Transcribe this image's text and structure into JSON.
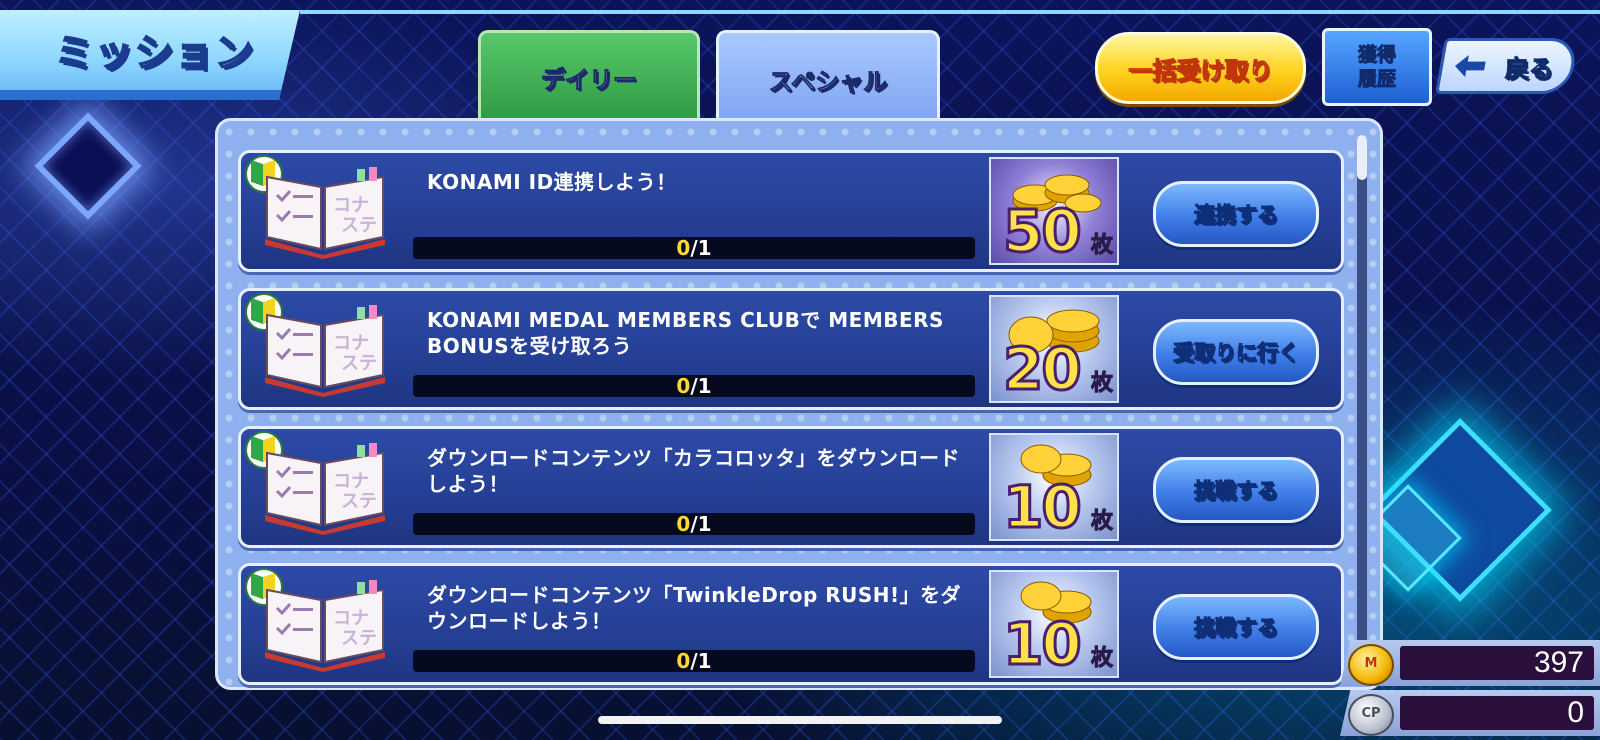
{
  "header": {
    "title": "ミッション"
  },
  "tabs": [
    {
      "label": "デイリー",
      "active": false
    },
    {
      "label": "スペシャル",
      "active": true
    }
  ],
  "toolbar": {
    "bulk_receive_label": "一括受け取り",
    "history_label_line1": "獲得",
    "history_label_line2": "履歴",
    "back_label": "戻る"
  },
  "missions": [
    {
      "title": "KONAMI ID連携しよう！",
      "progress_current": "0",
      "progress_total": "/1",
      "reward_amount": "50",
      "reward_unit": "枚",
      "action_label": "連携する"
    },
    {
      "title": "KONAMI MEDAL MEMBERS CLUBで MEMBERS BONUSを受け取ろう",
      "progress_current": "0",
      "progress_total": "/1",
      "reward_amount": "20",
      "reward_unit": "枚",
      "action_label": "受取りに行く"
    },
    {
      "title": "ダウンロードコンテンツ「カラコロッタ」をダウンロードしよう！",
      "progress_current": "0",
      "progress_total": "/1",
      "reward_amount": "10",
      "reward_unit": "枚",
      "action_label": "挑戦する"
    },
    {
      "title": "ダウンロードコンテンツ「TwinkleDrop RUSH!」をダウンロードしよう！",
      "progress_current": "0",
      "progress_total": "/1",
      "reward_amount": "10",
      "reward_unit": "枚",
      "action_label": "挑戦する"
    }
  ],
  "currency": {
    "medals": "397",
    "cp": "0",
    "medal_icon": "medal-coin-icon",
    "cp_icon": "cp-coin-icon",
    "medal_icon_text": "M",
    "cp_icon_text": "CP"
  },
  "colors": {
    "accent_gold": "#ffd21e",
    "tab_green": "#2f9a44",
    "action_blue": "#3f7ee8"
  }
}
